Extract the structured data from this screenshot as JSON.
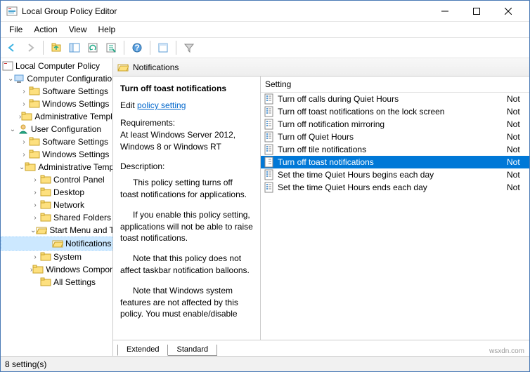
{
  "title": "Local Group Policy Editor",
  "menu": {
    "file": "File",
    "action": "Action",
    "view": "View",
    "help": "Help"
  },
  "toolbar": {
    "back": "back-icon",
    "fwd": "forward-icon",
    "up": "up-icon",
    "show": "show-icon",
    "refresh": "refresh-icon",
    "export": "export-icon",
    "help": "help-icon",
    "prop": "properties-icon",
    "filter": "filter-icon"
  },
  "tree": {
    "root": "Local Computer Policy",
    "cc": "Computer Configuration",
    "cc_children": [
      "Software Settings",
      "Windows Settings",
      "Administrative Templates"
    ],
    "uc": "User Configuration",
    "uc_children": [
      "Software Settings",
      "Windows Settings"
    ],
    "uc_at": "Administrative Templates",
    "at_children_top": [
      "Control Panel",
      "Desktop",
      "Network",
      "Shared Folders"
    ],
    "sm": "Start Menu and Taskbar",
    "notif": "Notifications",
    "at_children_bottom": [
      "System",
      "Windows Components",
      "All Settings"
    ]
  },
  "path_label": "Notifications",
  "detail": {
    "title": "Turn off toast notifications",
    "edit_prefix": "Edit",
    "edit_link": "policy setting",
    "req_label": "Requirements:",
    "req_text": "At least Windows Server 2012, Windows 8 or Windows RT",
    "desc_label": "Description:",
    "desc_p1": "This policy setting turns off toast notifications for applications.",
    "desc_p2": "If you enable this policy setting, applications will not be able to raise toast notifications.",
    "desc_p3": "Note that this policy does not affect taskbar notification balloons.",
    "desc_p4": "Note that Windows system features are not affected by this policy.  You must enable/disable"
  },
  "list": {
    "header_setting": "Setting",
    "state_truncated": "Not",
    "items": [
      {
        "name": "Turn off calls during Quiet Hours"
      },
      {
        "name": "Turn off toast notifications on the lock screen"
      },
      {
        "name": "Turn off notification mirroring"
      },
      {
        "name": "Turn off Quiet Hours"
      },
      {
        "name": "Turn off tile notifications"
      },
      {
        "name": "Turn off toast notifications",
        "selected": true
      },
      {
        "name": "Set the time Quiet Hours begins each day"
      },
      {
        "name": "Set the time Quiet Hours ends each day"
      }
    ]
  },
  "tabs": {
    "extended": "Extended",
    "standard": "Standard"
  },
  "status": "8 setting(s)",
  "watermark": "wsxdn.com"
}
